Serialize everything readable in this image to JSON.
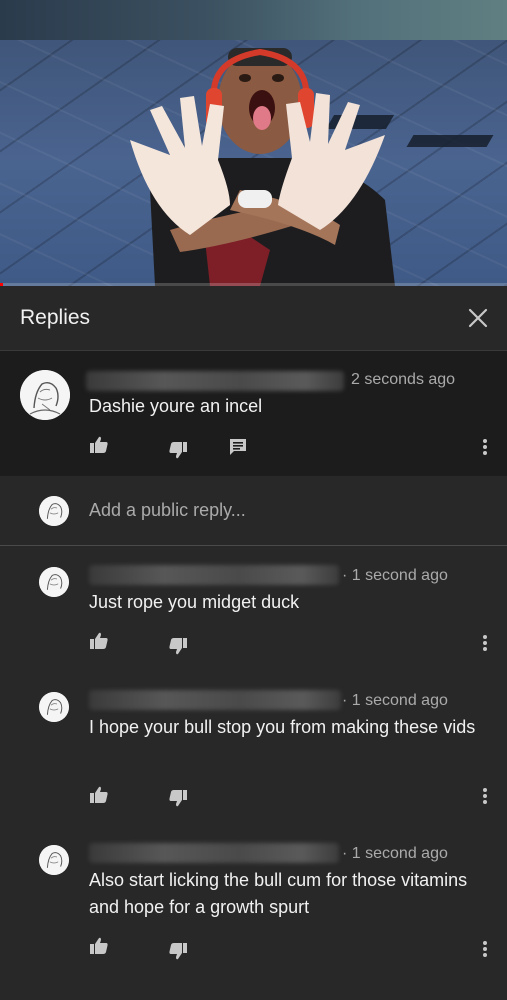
{
  "header": {
    "title": "Replies",
    "close_icon": "close-icon"
  },
  "video": {
    "progress_percent": 0.5
  },
  "main_comment": {
    "timestamp": "2 seconds ago",
    "text": "Dashie youre an incel",
    "actions": [
      "like-icon",
      "dislike-icon",
      "reply-icon",
      "more-vert-icon"
    ]
  },
  "add_reply": {
    "placeholder": "Add a public reply..."
  },
  "replies": [
    {
      "timestamp": "1 second ago",
      "text": "Just rope you midget duck"
    },
    {
      "timestamp": "1 second ago",
      "text": "I hope your bull stop you from making these vids"
    },
    {
      "timestamp": "1 second ago",
      "text": "Also start licking the bull cum for those vitamins and hope for a growth spurt"
    }
  ],
  "colors": {
    "background": "#282828",
    "highlight": "#1c1c1c",
    "text": "#f1f1f1",
    "secondary": "#aaaaaa",
    "progress": "#ff0000"
  }
}
